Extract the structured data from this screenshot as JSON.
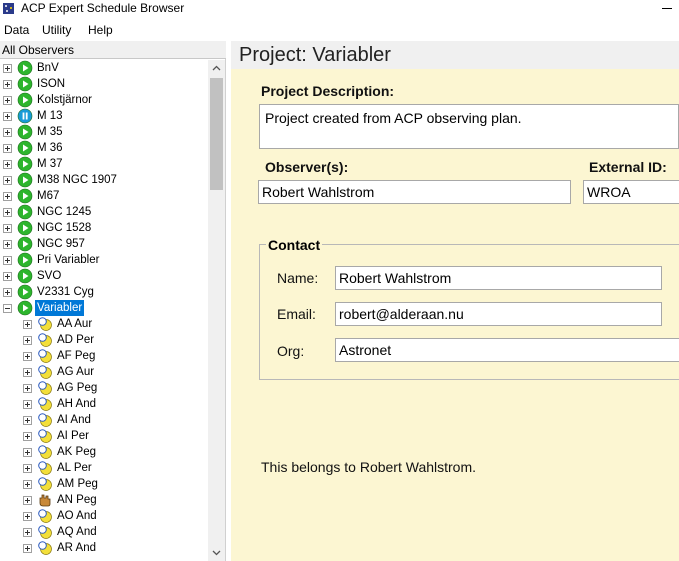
{
  "window": {
    "title": "ACP Expert Schedule Browser"
  },
  "menu": [
    "Data",
    "Utility",
    "Help"
  ],
  "tree": {
    "header": "All Observers",
    "observers": [
      {
        "label": "BnV",
        "status": "active"
      },
      {
        "label": "ISON",
        "status": "active"
      },
      {
        "label": "Kolstjärnor",
        "status": "active"
      },
      {
        "label": "M 13",
        "status": "paused"
      },
      {
        "label": "M 35",
        "status": "active"
      },
      {
        "label": "M 36",
        "status": "active"
      },
      {
        "label": "M 37",
        "status": "active"
      },
      {
        "label": "M38 NGC 1907",
        "status": "active"
      },
      {
        "label": "M67",
        "status": "active"
      },
      {
        "label": "NGC 1245",
        "status": "active"
      },
      {
        "label": "NGC 1528",
        "status": "active"
      },
      {
        "label": "NGC 957",
        "status": "active"
      },
      {
        "label": "Pri Variabler",
        "status": "active"
      },
      {
        "label": "SVO",
        "status": "active"
      },
      {
        "label": "V2331 Cyg",
        "status": "active"
      },
      {
        "label": "Variabler",
        "status": "active",
        "expanded": true,
        "selected": true
      }
    ],
    "targets": [
      {
        "label": "AA Aur",
        "icon": "target"
      },
      {
        "label": "AD Per",
        "icon": "target"
      },
      {
        "label": "AF Peg",
        "icon": "target"
      },
      {
        "label": "AG Aur",
        "icon": "target"
      },
      {
        "label": "AG Peg",
        "icon": "target"
      },
      {
        "label": "AH And",
        "icon": "target"
      },
      {
        "label": "AI And",
        "icon": "target"
      },
      {
        "label": "AI Per",
        "icon": "target"
      },
      {
        "label": "AK Peg",
        "icon": "target"
      },
      {
        "label": "AL Per",
        "icon": "target"
      },
      {
        "label": "AM Peg",
        "icon": "target"
      },
      {
        "label": "AN Peg",
        "icon": "hand"
      },
      {
        "label": "AO And",
        "icon": "target"
      },
      {
        "label": "AQ And",
        "icon": "target"
      },
      {
        "label": "AR And",
        "icon": "target"
      }
    ]
  },
  "project": {
    "title": "Project: Variabler",
    "description_label": "Project Description:",
    "description": "Project created from ACP observing plan.",
    "observers_label": "Observer(s):",
    "observers": "Robert Wahlstrom",
    "external_id_label": "External ID:",
    "external_id": "WROA",
    "contact_label": "Contact",
    "name_label": "Name:",
    "name": "Robert Wahlstrom",
    "email_label": "Email:",
    "email": "robert@alderaan.nu",
    "org_label": "Org:",
    "org": "Astronet",
    "note": "This belongs to Robert Wahlstrom."
  },
  "colors": {
    "selection": "#0078d7",
    "detail_background": "#fcf6d2",
    "status_active": "#2db52d",
    "status_paused": "#1a9bd7"
  }
}
